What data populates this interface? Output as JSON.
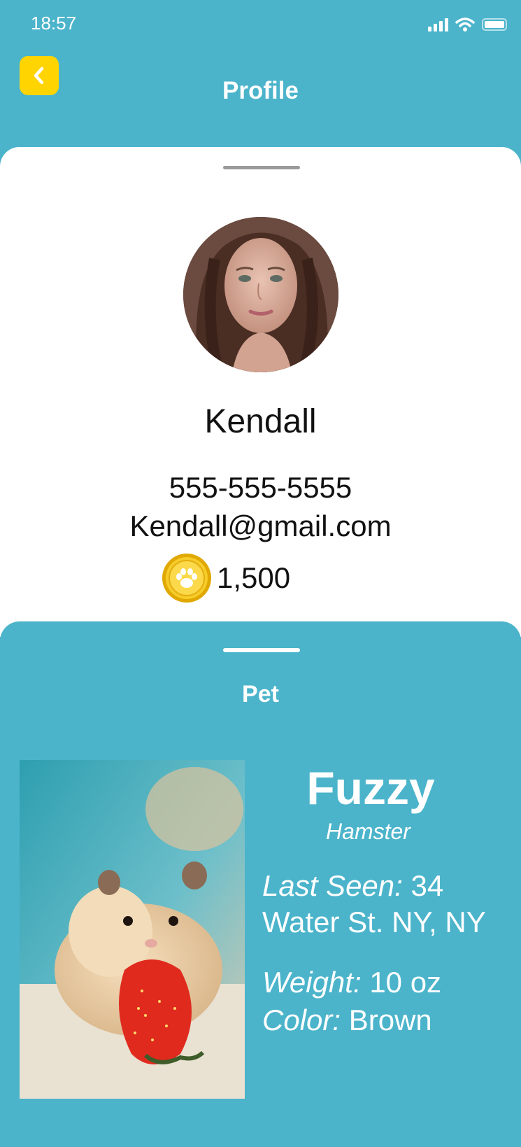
{
  "status_bar": {
    "time": "18:57",
    "icons": [
      "signal-icon",
      "wifi-icon",
      "battery-icon"
    ]
  },
  "header": {
    "back_icon": "chevron-left-icon",
    "title": "Profile"
  },
  "profile": {
    "name": "Kendall",
    "phone": "555-555-5555",
    "email": "Kendall@gmail.com",
    "coin_icon": "paw-coin-icon",
    "coin_balance": "1,500"
  },
  "pet_section": {
    "title": "Pet",
    "pet": {
      "name": "Fuzzy",
      "species": "Hamster",
      "last_seen_label": "Last Seen:",
      "last_seen_line1": "34",
      "last_seen_line2": "Water St. NY, NY",
      "weight_label": "Weight:",
      "weight_value": "10 oz",
      "color_label": "Color:",
      "color_value": "Brown"
    }
  },
  "colors": {
    "background": "#4bb4cb",
    "card": "#ffffff",
    "back_button": "#ffd400",
    "coin": "#f4c21a",
    "text_dark": "#111111"
  }
}
